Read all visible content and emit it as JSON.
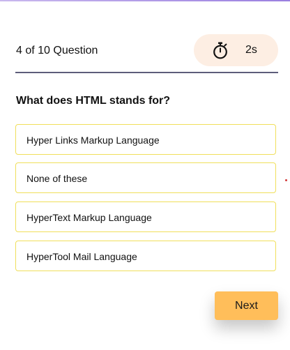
{
  "header": {
    "progress": "4 of 10 Question",
    "timer": {
      "icon": "stopwatch-icon",
      "value": "2s"
    }
  },
  "question": {
    "text": "What does HTML stands for?"
  },
  "options": [
    {
      "label": "Hyper Links Markup Language"
    },
    {
      "label": "None of these"
    },
    {
      "label": "HyperText Markup Language"
    },
    {
      "label": "HyperTool Mail Language"
    }
  ],
  "actions": {
    "next_label": "Next"
  },
  "colors": {
    "accent_top": "#9a7fe0",
    "timer_bg": "#fdeee3",
    "divider": "#5d5d7a",
    "option_border": "#f0df5a",
    "next_bg": "#ffbe5a"
  }
}
